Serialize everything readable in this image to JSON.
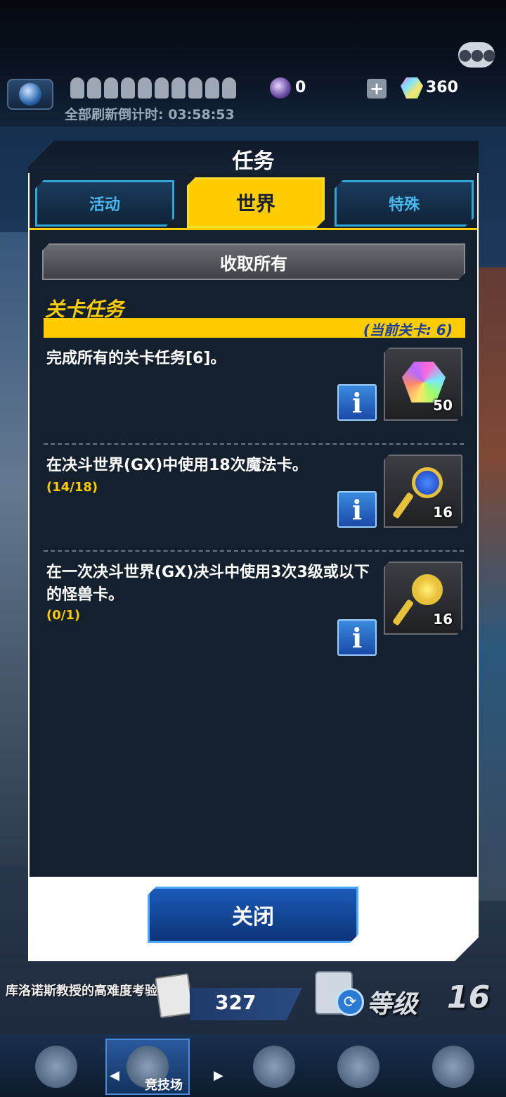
{
  "status": {
    "orb_count": "0",
    "gem_count": "360",
    "refresh_timer": "全部刷新倒计时: 03:58:53",
    "chat_icon": "chat-bubble-icon",
    "plus_label": "+"
  },
  "modal": {
    "title": "任务",
    "tabs": [
      {
        "label": "活动",
        "active": false
      },
      {
        "label": "世界",
        "active": true
      },
      {
        "label": "特殊",
        "active": false
      }
    ],
    "collect_all_label": "收取所有",
    "section_title": "关卡任务",
    "current_stage": "(当前关卡: 6)",
    "tasks": [
      {
        "text": "完成所有的关卡任务[6]。",
        "progress": "",
        "reward_count": "50",
        "reward_icon": "rainbow-gem-icon"
      },
      {
        "text": "在决斗世界(GX)中使用18次魔法卡。",
        "progress": "(14/18)",
        "reward_count": "16",
        "reward_icon": "blue-key-icon"
      },
      {
        "text": "在一次决斗世界(GX)决斗中使用3次3级或以下的怪兽卡。",
        "progress": "(0/1)",
        "reward_count": "16",
        "reward_icon": "gold-key-icon"
      }
    ],
    "info_label": "i",
    "close_label": "关闭"
  },
  "hud": {
    "event_banner": "库洛诺斯教授的高难度考验",
    "deck_count": "327",
    "level_label": "等级",
    "level_value": "16",
    "arena_label": "竞技场",
    "arrow_left": "◀",
    "arrow_right": "▶"
  },
  "colors": {
    "accent_yellow": "#ffcc00",
    "tab_blue": "#48b8ee",
    "panel_bg": "#15202e",
    "close_blue": "#1a5ab8"
  }
}
